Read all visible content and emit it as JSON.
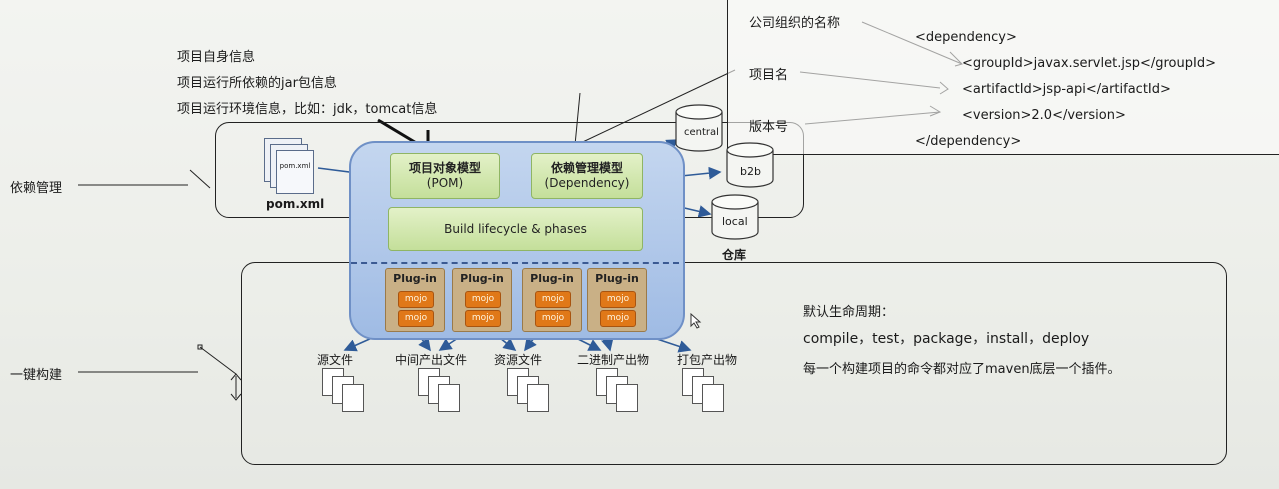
{
  "notes": {
    "project_info": "项目自身信息",
    "jar_info": "项目运行所依赖的jar包信息",
    "env_info": "项目运行环境信息，比如：jdk，tomcat信息",
    "dependency_mgmt": "依赖管理",
    "one_click_build": "一键构建"
  },
  "dependency_panel": {
    "org_name": "公司组织的名称",
    "project_name": "项目名",
    "version_label": "版本号",
    "xml_lines": [
      "<dependency>",
      "<groupId>javax.servlet.jsp</groupId>",
      "<artifactId>jsp-api</artifactId>",
      "<version>2.0</version>",
      "</dependency>"
    ]
  },
  "diagram": {
    "pom_file_icon_label": "pom.xml",
    "pom_file": "pom.xml",
    "pom_model": [
      "项目对象模型",
      "(POM)"
    ],
    "dependency_model": [
      "依赖管理模型",
      "(Dependency)"
    ],
    "lifecycle": "Build lifecycle & phases",
    "plugins": [
      {
        "label": "Plug-in",
        "mojo": "mojo"
      },
      {
        "label": "Plug-in",
        "mojo": "mojo"
      },
      {
        "label": "Plug-in",
        "mojo": "mojo"
      },
      {
        "label": "Plug-in",
        "mojo": "mojo"
      }
    ],
    "repos": [
      "central",
      "b2b",
      "local"
    ],
    "repo_caption": "仓库",
    "outputs": [
      "源文件",
      "中间产出文件",
      "资源文件",
      "二进制产出物",
      "打包产出物"
    ]
  },
  "lifecycle_info": {
    "title": "默认生命周期：",
    "phases": "compile，test，package，install，deploy",
    "note": "每一个构建项目的命令都对应了maven底层一个插件。"
  }
}
